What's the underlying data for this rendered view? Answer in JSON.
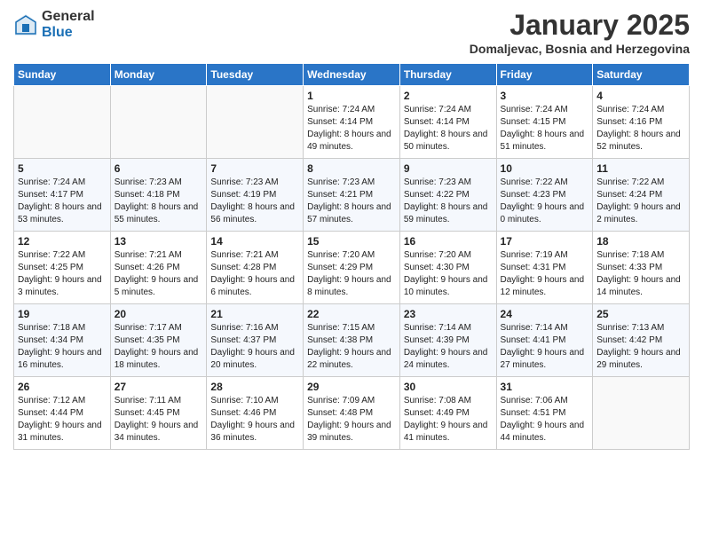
{
  "logo": {
    "general": "General",
    "blue": "Blue"
  },
  "title": "January 2025",
  "subtitle": "Domaljevac, Bosnia and Herzegovina",
  "days_header": [
    "Sunday",
    "Monday",
    "Tuesday",
    "Wednesday",
    "Thursday",
    "Friday",
    "Saturday"
  ],
  "weeks": [
    [
      {
        "day": "",
        "info": ""
      },
      {
        "day": "",
        "info": ""
      },
      {
        "day": "",
        "info": ""
      },
      {
        "day": "1",
        "info": "Sunrise: 7:24 AM\nSunset: 4:14 PM\nDaylight: 8 hours\nand 49 minutes."
      },
      {
        "day": "2",
        "info": "Sunrise: 7:24 AM\nSunset: 4:14 PM\nDaylight: 8 hours\nand 50 minutes."
      },
      {
        "day": "3",
        "info": "Sunrise: 7:24 AM\nSunset: 4:15 PM\nDaylight: 8 hours\nand 51 minutes."
      },
      {
        "day": "4",
        "info": "Sunrise: 7:24 AM\nSunset: 4:16 PM\nDaylight: 8 hours\nand 52 minutes."
      }
    ],
    [
      {
        "day": "5",
        "info": "Sunrise: 7:24 AM\nSunset: 4:17 PM\nDaylight: 8 hours\nand 53 minutes."
      },
      {
        "day": "6",
        "info": "Sunrise: 7:23 AM\nSunset: 4:18 PM\nDaylight: 8 hours\nand 55 minutes."
      },
      {
        "day": "7",
        "info": "Sunrise: 7:23 AM\nSunset: 4:19 PM\nDaylight: 8 hours\nand 56 minutes."
      },
      {
        "day": "8",
        "info": "Sunrise: 7:23 AM\nSunset: 4:21 PM\nDaylight: 8 hours\nand 57 minutes."
      },
      {
        "day": "9",
        "info": "Sunrise: 7:23 AM\nSunset: 4:22 PM\nDaylight: 8 hours\nand 59 minutes."
      },
      {
        "day": "10",
        "info": "Sunrise: 7:22 AM\nSunset: 4:23 PM\nDaylight: 9 hours\nand 0 minutes."
      },
      {
        "day": "11",
        "info": "Sunrise: 7:22 AM\nSunset: 4:24 PM\nDaylight: 9 hours\nand 2 minutes."
      }
    ],
    [
      {
        "day": "12",
        "info": "Sunrise: 7:22 AM\nSunset: 4:25 PM\nDaylight: 9 hours\nand 3 minutes."
      },
      {
        "day": "13",
        "info": "Sunrise: 7:21 AM\nSunset: 4:26 PM\nDaylight: 9 hours\nand 5 minutes."
      },
      {
        "day": "14",
        "info": "Sunrise: 7:21 AM\nSunset: 4:28 PM\nDaylight: 9 hours\nand 6 minutes."
      },
      {
        "day": "15",
        "info": "Sunrise: 7:20 AM\nSunset: 4:29 PM\nDaylight: 9 hours\nand 8 minutes."
      },
      {
        "day": "16",
        "info": "Sunrise: 7:20 AM\nSunset: 4:30 PM\nDaylight: 9 hours\nand 10 minutes."
      },
      {
        "day": "17",
        "info": "Sunrise: 7:19 AM\nSunset: 4:31 PM\nDaylight: 9 hours\nand 12 minutes."
      },
      {
        "day": "18",
        "info": "Sunrise: 7:18 AM\nSunset: 4:33 PM\nDaylight: 9 hours\nand 14 minutes."
      }
    ],
    [
      {
        "day": "19",
        "info": "Sunrise: 7:18 AM\nSunset: 4:34 PM\nDaylight: 9 hours\nand 16 minutes."
      },
      {
        "day": "20",
        "info": "Sunrise: 7:17 AM\nSunset: 4:35 PM\nDaylight: 9 hours\nand 18 minutes."
      },
      {
        "day": "21",
        "info": "Sunrise: 7:16 AM\nSunset: 4:37 PM\nDaylight: 9 hours\nand 20 minutes."
      },
      {
        "day": "22",
        "info": "Sunrise: 7:15 AM\nSunset: 4:38 PM\nDaylight: 9 hours\nand 22 minutes."
      },
      {
        "day": "23",
        "info": "Sunrise: 7:14 AM\nSunset: 4:39 PM\nDaylight: 9 hours\nand 24 minutes."
      },
      {
        "day": "24",
        "info": "Sunrise: 7:14 AM\nSunset: 4:41 PM\nDaylight: 9 hours\nand 27 minutes."
      },
      {
        "day": "25",
        "info": "Sunrise: 7:13 AM\nSunset: 4:42 PM\nDaylight: 9 hours\nand 29 minutes."
      }
    ],
    [
      {
        "day": "26",
        "info": "Sunrise: 7:12 AM\nSunset: 4:44 PM\nDaylight: 9 hours\nand 31 minutes."
      },
      {
        "day": "27",
        "info": "Sunrise: 7:11 AM\nSunset: 4:45 PM\nDaylight: 9 hours\nand 34 minutes."
      },
      {
        "day": "28",
        "info": "Sunrise: 7:10 AM\nSunset: 4:46 PM\nDaylight: 9 hours\nand 36 minutes."
      },
      {
        "day": "29",
        "info": "Sunrise: 7:09 AM\nSunset: 4:48 PM\nDaylight: 9 hours\nand 39 minutes."
      },
      {
        "day": "30",
        "info": "Sunrise: 7:08 AM\nSunset: 4:49 PM\nDaylight: 9 hours\nand 41 minutes."
      },
      {
        "day": "31",
        "info": "Sunrise: 7:06 AM\nSunset: 4:51 PM\nDaylight: 9 hours\nand 44 minutes."
      },
      {
        "day": "",
        "info": ""
      }
    ]
  ]
}
